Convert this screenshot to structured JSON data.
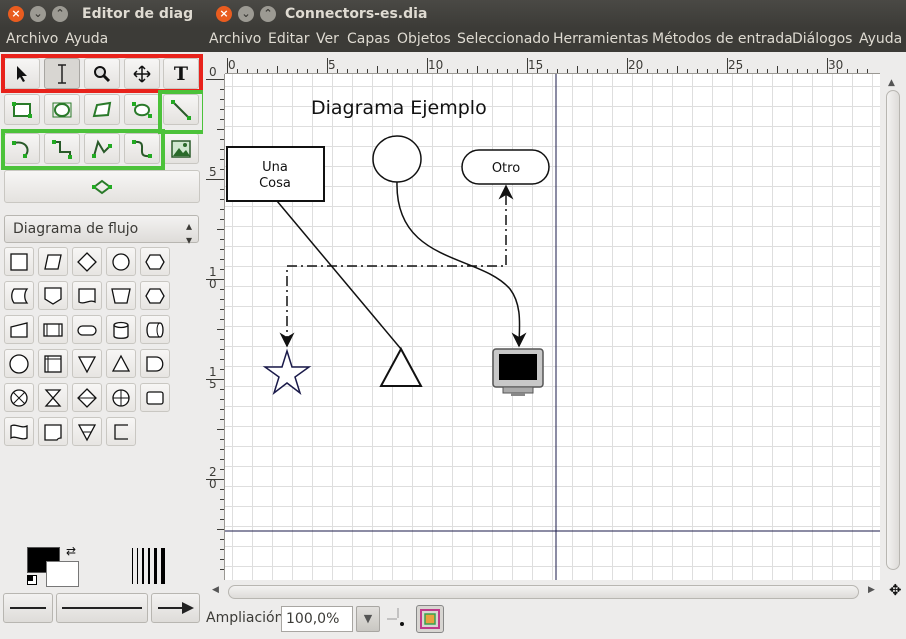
{
  "toolbox": {
    "title": "Editor de diag",
    "menu": [
      "Archivo",
      "Ayuda"
    ],
    "sheet_select": "Diagrama de flujo",
    "text_tool_glyph": "T",
    "colors": {
      "foreground": "#000000",
      "background": "#ffffff"
    },
    "highlight_red": "#e8221b",
    "highlight_green": "#4cc23a"
  },
  "diagram": {
    "title": "Connectors-es.dia",
    "menu": [
      "Archivo",
      "Editar",
      "Ver",
      "Capas",
      "Objetos",
      "Seleccionado",
      "Herramientas",
      "Métodos de entrada",
      "Diálogos",
      "Ayuda"
    ],
    "ruler_h": [
      "0",
      "5",
      "10",
      "15",
      "20",
      "25",
      "30"
    ],
    "ruler_v": [
      "0",
      "5",
      "1\n0",
      "1\n5",
      "2\n0"
    ],
    "canvas": {
      "heading": "Diagrama Ejemplo",
      "box1_line1": "Una",
      "box1_line2": "Cosa",
      "box2": "Otro"
    },
    "status": {
      "zoom_label": "Ampliación",
      "zoom_value": "100,0%"
    }
  }
}
